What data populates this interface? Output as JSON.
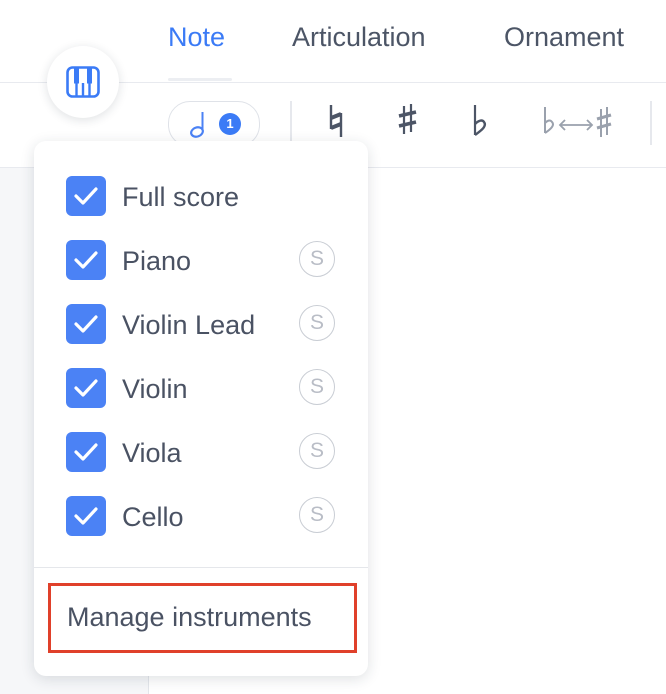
{
  "tabs": [
    {
      "label": "Note",
      "active": true
    },
    {
      "label": "Articulation",
      "active": false
    },
    {
      "label": "Ornament",
      "active": false
    }
  ],
  "toolbar": {
    "voice_count": "1",
    "tools": [
      "natural-icon",
      "sharp-icon",
      "flat-icon",
      "enharmonic-flip-icon"
    ]
  },
  "piano_button": {
    "icon": "piano-icon"
  },
  "instruments_popup": {
    "items": [
      {
        "label": "Full score",
        "checked": true,
        "solo": false
      },
      {
        "label": "Piano",
        "checked": true,
        "solo": true,
        "solo_label": "S"
      },
      {
        "label": "Violin Lead",
        "checked": true,
        "solo": true,
        "solo_label": "S"
      },
      {
        "label": "Violin",
        "checked": true,
        "solo": true,
        "solo_label": "S"
      },
      {
        "label": "Viola",
        "checked": true,
        "solo": true,
        "solo_label": "S"
      },
      {
        "label": "Cello",
        "checked": true,
        "solo": true,
        "solo_label": "S"
      }
    ],
    "manage_label": "Manage instruments"
  },
  "colors": {
    "accent": "#3b7bf6",
    "checkbox": "#4b82f5",
    "highlight_border": "#e0402a",
    "text": "#4a5263"
  }
}
